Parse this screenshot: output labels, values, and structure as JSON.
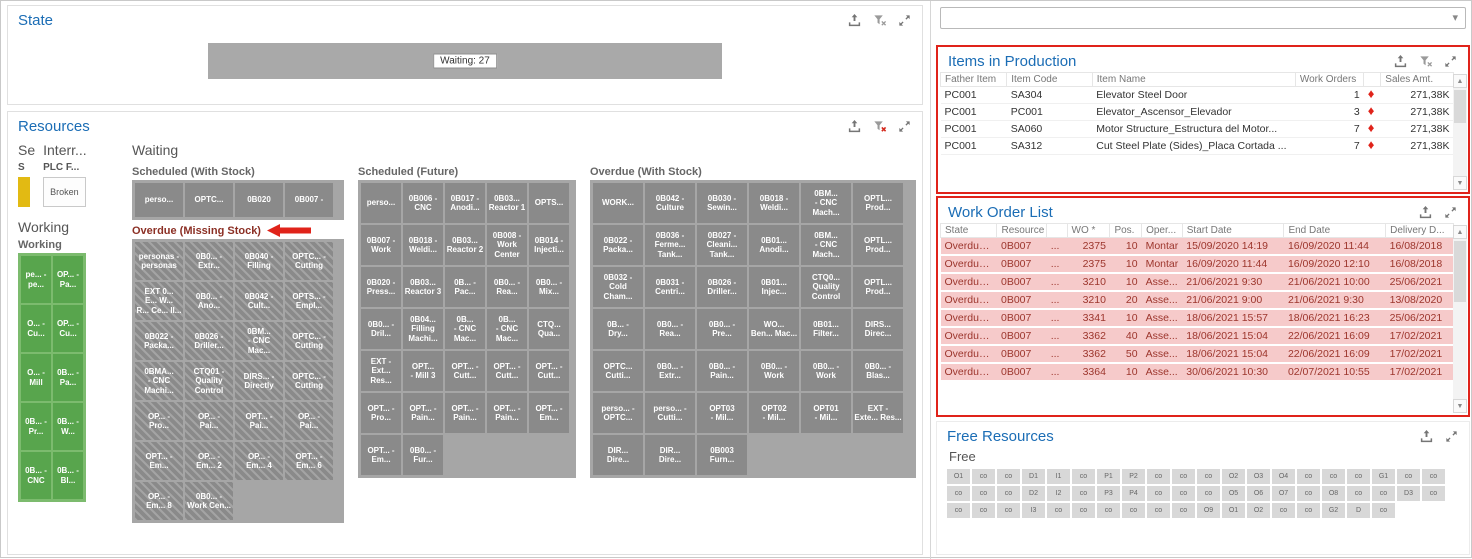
{
  "icons": {
    "diamond": "♦",
    "scroll_up": "▲",
    "scroll_down": "▼",
    "dropdown": "▾"
  },
  "colors": {
    "accent_blue": "#1b6db5",
    "annotation_red": "#e0231a",
    "overdue_row_bg": "#f6caca",
    "overdue_text": "#9c352c",
    "tile_gray": "#8a8a8a",
    "working_green": "#58a54d",
    "setup_yellow": "#e2ba13"
  },
  "chart_data": {
    "type": "bar",
    "orientation": "horizontal",
    "title": "State",
    "categories": [
      "Waiting"
    ],
    "values": [
      27
    ],
    "bar_label": "Waiting: 27",
    "legend": "off",
    "grid": "off"
  },
  "state_panel": {
    "title": "State",
    "bar_label": "Waiting: 27"
  },
  "resources_panel": {
    "title": "Resources",
    "columns": {
      "setup": "Se",
      "interrupted": "Interr...",
      "waiting": "Waiting",
      "working": "Working"
    },
    "setup": {
      "sub_label": "S"
    },
    "interrupted": {
      "sub_label": "PLC F...",
      "tile": "Broken"
    },
    "working": {
      "label": "Working",
      "tiles": [
        "pe... -\npe...",
        "OP... -\nPa...",
        "O... -\nCu...",
        "OP... -\nCu...",
        "O... -\nMill",
        "0B... -\nPa...",
        "0B... -\nPr...",
        "0B... -\nW...",
        "0B... -\nCNC",
        "0B... -\nBl..."
      ]
    },
    "waiting": {
      "scheduled_with_stock": {
        "label": "Scheduled (With Stock)",
        "tiles": [
          "perso...",
          "OPTC...",
          "0B020",
          "0B007 -"
        ]
      },
      "overdue_missing_stock": {
        "label": "Overdue (Missing Stock)",
        "tiles": [
          "personas -\npersonas",
          "0B0... -\nExtr...",
          "0B040 -\nFilling",
          "OPTC... -\nCutting",
          "EXT 0...\nE... W...\nR... Ce... II...",
          "0B0... -\nAno...",
          "0B042 -\nCult...",
          "OPTS... -\nEmpl...",
          "0B022 -\nPacka...",
          "0B026 -\nDriller...",
          "0BM...\n- CNC\nMac...",
          "OPTC... -\nCutting",
          "0BMA...\n- CNC\nMachi...",
          "CTQ01 -\nQuality\nControl",
          "DIRS... -\nDirectly",
          "OPTC... -\nCutting",
          "OP... -\nPro...",
          "OP... -\nPai...",
          "OPT... -\nPai...",
          "OP... -\nPai...",
          "OPT... -\nEm...",
          "OP... -\nEm... 2",
          "OP... -\nEm... 4",
          "OPT... -\nEm... 6",
          "OP... -\nEm... 8",
          "0B0... -\nWork Cen..."
        ]
      },
      "scheduled_future": {
        "label": "Scheduled (Future)",
        "tiles": [
          "perso...",
          "0B006 -\nCNC",
          "0B017 -\nAnodi...",
          "0B03...\nReactor 1",
          "OPTS...",
          "0B007 -\nWork",
          "0B018 -\nWeldi...",
          "0B03...\nReactor 2",
          "0B008 -\nWork Center",
          "0B014 -\nInjecti...",
          "0B020 -\nPress...",
          "0B03...\nReactor 3",
          "0B... -\nPac...",
          "0B0... -\nRea...",
          "0B0... -\nMix...",
          "0B0... -\nDril...",
          "0B04...\nFilling Machi...",
          "0B...\n- CNC\nMac...",
          "0B...\n- CNC\nMac...",
          "CTQ...\nQua...",
          "EXT -\nExt... Res...",
          "OPT...\n- Mill 3",
          "OPT... -\nCutt...",
          "OPT... -\nCutt...",
          "OPT... -\nCutt...",
          "OPT... -\nPro...",
          "OPT... -\nPain...",
          "OPT... -\nPain...",
          "OPT... -\nPain...",
          "OPT... -\nEm...",
          "OPT... -\nEm...",
          "0B0... -\nFur..."
        ]
      },
      "overdue_with_stock": {
        "label": "Overdue (With Stock)",
        "tiles": [
          "WORK...",
          "0B042 -\nCulture",
          "0B030 -\nSewin...",
          "0B018 -\nWeldi...",
          "0BM...\n- CNC\nMach...",
          "OPTL...\nProd...",
          "0B022 -\nPacka...",
          "0B036 -\nFerme... Tank...",
          "0B027 -\nCleani... Tank...",
          "0B01...\nAnodi...",
          "0BM...\n- CNC\nMach...",
          "OPTL...\nProd...",
          "0B032 -\nCold Cham...",
          "0B031 -\nCentri...",
          "0B026 -\nDriller...",
          "0B01...\nInjec...",
          "CTQ0...\nQuality Control",
          "OPTL...\nProd...",
          "0B... -\nDry...",
          "0B0... -\nRea...",
          "0B0... -\nPre...",
          "WO...\nBen... Mac...",
          "0B01...\nFilter...",
          "DIRS...\nDirec...",
          "OPTC...\nCutti...",
          "0B0... -\nExtr...",
          "0B0... -\nPain...",
          "0B0... -\nWork",
          "0B0... -\nWork",
          "0B0... -\nBlas...",
          "perso... -\nOPTC...",
          "perso... -\nCutti...",
          "OPT03\n- Mil...",
          "OPT02\n- Mil...",
          "OPT01\n- Mil...",
          "EXT -\nExte... Res...",
          "DIR...\nDire...",
          "DIR...\nDire...",
          "0B003\nFurn..."
        ]
      }
    }
  },
  "sidebar": {
    "combo_value": "",
    "items_in_production": {
      "title": "Items in Production",
      "headers": {
        "father": "Father Item",
        "code": "Item Code",
        "name": "Item Name",
        "wo": "Work Orders",
        "amt": "Sales Amt."
      },
      "rows": [
        {
          "father": "PC001",
          "code": "SA304",
          "name": "Elevator Steel Door",
          "wo": "1",
          "amt": "271,38K"
        },
        {
          "father": "PC001",
          "code": "PC001",
          "name": "Elevator_Ascensor_Elevador",
          "wo": "3",
          "amt": "271,38K"
        },
        {
          "father": "PC001",
          "code": "SA060",
          "name": "Motor Structure_Estructura del Motor...",
          "wo": "7",
          "amt": "271,38K"
        },
        {
          "father": "PC001",
          "code": "SA312",
          "name": "Cut Steel Plate (Sides)_Placa Cortada ...",
          "wo": "7",
          "amt": "271,38K"
        }
      ]
    },
    "work_order_list": {
      "title": "Work Order List",
      "headers": {
        "state": "State",
        "resource": "Resource",
        "wo": "WO *",
        "pos": "Pos.",
        "oper": "Oper...",
        "start": "Start Date",
        "end": "End Date",
        "delivery": "Delivery D..."
      },
      "rows": [
        {
          "state": "Overdue...",
          "resource": "0B007",
          "more": "...",
          "wo": "2375",
          "pos": "10",
          "oper": "Montar",
          "start": "15/09/2020 14:19",
          "end": "16/09/2020 11:44",
          "delivery": "16/08/2018"
        },
        {
          "state": "Overdue...",
          "resource": "0B007",
          "more": "...",
          "wo": "2375",
          "pos": "10",
          "oper": "Montar",
          "start": "16/09/2020 11:44",
          "end": "16/09/2020 12:10",
          "delivery": "16/08/2018"
        },
        {
          "state": "Overdue...",
          "resource": "0B007",
          "more": "...",
          "wo": "3210",
          "pos": "10",
          "oper": "Asse...",
          "start": "21/06/2021 9:30",
          "end": "21/06/2021 10:00",
          "delivery": "25/06/2021"
        },
        {
          "state": "Overdue...",
          "resource": "0B007",
          "more": "...",
          "wo": "3210",
          "pos": "20",
          "oper": "Asse...",
          "start": "21/06/2021 9:00",
          "end": "21/06/2021 9:30",
          "delivery": "13/08/2020"
        },
        {
          "state": "Overdue...",
          "resource": "0B007",
          "more": "...",
          "wo": "3341",
          "pos": "10",
          "oper": "Asse...",
          "start": "18/06/2021 15:57",
          "end": "18/06/2021 16:23",
          "delivery": "25/06/2021"
        },
        {
          "state": "Overdue...",
          "resource": "0B007",
          "more": "...",
          "wo": "3362",
          "pos": "40",
          "oper": "Asse...",
          "start": "18/06/2021 15:04",
          "end": "22/06/2021 16:09",
          "delivery": "17/02/2021"
        },
        {
          "state": "Overdue...",
          "resource": "0B007",
          "more": "...",
          "wo": "3362",
          "pos": "50",
          "oper": "Asse...",
          "start": "18/06/2021 15:04",
          "end": "22/06/2021 16:09",
          "delivery": "17/02/2021"
        },
        {
          "state": "Overdue...",
          "resource": "0B007",
          "more": "...",
          "wo": "3364",
          "pos": "10",
          "oper": "Asse...",
          "start": "30/06/2021 10:30",
          "end": "02/07/2021 10:55",
          "delivery": "17/02/2021"
        }
      ]
    },
    "free_resources": {
      "title": "Free Resources",
      "label": "Free",
      "tiles": [
        "O1",
        "co",
        "co",
        "D1",
        "I1",
        "co",
        "P1",
        "P2",
        "co",
        "co",
        "co",
        "O2",
        "O3",
        "O4",
        "co",
        "co",
        "co",
        "G1",
        "co",
        "co",
        "co",
        "co",
        "co",
        "D2",
        "I2",
        "co",
        "P3",
        "P4",
        "co",
        "co",
        "co",
        "O5",
        "O6",
        "O7",
        "co",
        "O8",
        "co",
        "co",
        "D3",
        "co",
        "co",
        "co",
        "co",
        "I3",
        "co",
        "co",
        "co",
        "co",
        "co",
        "co",
        "O9",
        "O1",
        "O2",
        "co",
        "co",
        "G2",
        "D",
        "co"
      ]
    }
  }
}
